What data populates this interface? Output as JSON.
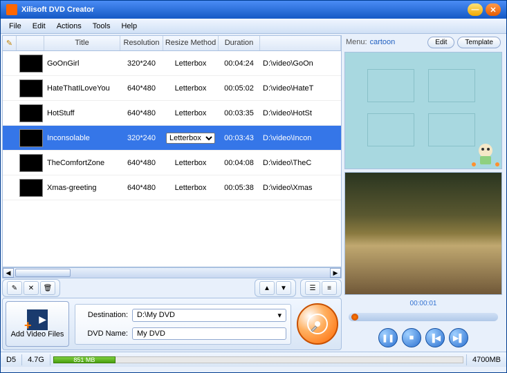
{
  "title": "Xilisoft DVD Creator",
  "menus": [
    "File",
    "Edit",
    "Actions",
    "Tools",
    "Help"
  ],
  "columns": {
    "c0": "",
    "c1": "",
    "title": "Title",
    "resolution": "Resolution",
    "resize": "Resize Method",
    "duration": "Duration",
    "path": ""
  },
  "rows": [
    {
      "title": "GoOnGirl",
      "res": "320*240",
      "resize": "Letterbox",
      "dur": "00:04:24",
      "path": "D:\\video\\GoOn"
    },
    {
      "title": "HateThatILoveYou",
      "res": "640*480",
      "resize": "Letterbox",
      "dur": "00:05:02",
      "path": "D:\\video\\HateT"
    },
    {
      "title": "HotStuff",
      "res": "640*480",
      "resize": "Letterbox",
      "dur": "00:03:35",
      "path": "D:\\video\\HotSt"
    },
    {
      "title": "Inconsolable",
      "res": "320*240",
      "resize": "Letterbox",
      "dur": "00:03:43",
      "path": "D:\\video\\Incon"
    },
    {
      "title": "TheComfortZone",
      "res": "640*480",
      "resize": "Letterbox",
      "dur": "00:04:08",
      "path": "D:\\video\\TheC"
    },
    {
      "title": "Xmas-greeting",
      "res": "640*480",
      "resize": "Letterbox",
      "dur": "00:05:38",
      "path": "D:\\video\\Xmas"
    }
  ],
  "selected_row": 3,
  "resize_options": [
    "Letterbox"
  ],
  "add_label": "Add Video Files",
  "dest_label": "Destination:",
  "dest_value": "D:\\My DVD",
  "name_label": "DVD Name:",
  "name_value": "My DVD",
  "disc_type": "D5",
  "disc_cap": "4.7G",
  "used_mb": "851 MB",
  "total_mb": "4700MB",
  "menu_label": "Menu:",
  "menu_name": "cartoon",
  "edit_btn": "Edit",
  "template_btn": "Template",
  "playtime": "00:00:01",
  "icons": {
    "pause": "❚❚",
    "stop": "■",
    "prev": "▐◀",
    "next": "▶▌",
    "up": "▲",
    "down": "▼",
    "edit": "✎",
    "del": "✕",
    "trash": "🗑",
    "list1": "☰",
    "list2": "≡",
    "dd": "▾",
    "l": "◀",
    "r": "▶"
  }
}
